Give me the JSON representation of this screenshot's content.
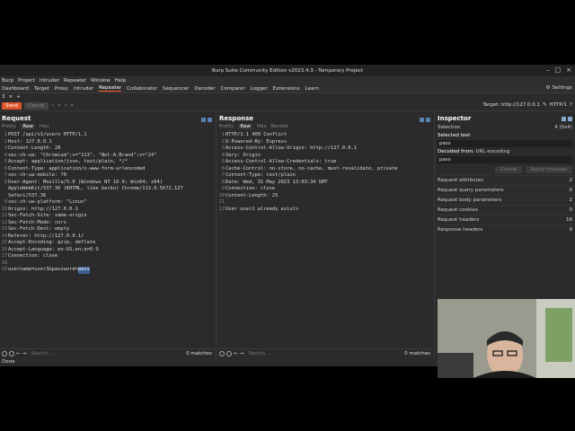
{
  "window": {
    "title": "Burp Suite Community Edition v2023.4.3 - Temporary Project",
    "controls": [
      "–",
      "□",
      "×"
    ]
  },
  "menu": [
    "Burp",
    "Project",
    "Intruder",
    "Repeater",
    "Window",
    "Help"
  ],
  "tabs": [
    "Dashboard",
    "Target",
    "Proxy",
    "Intruder",
    "Repeater",
    "Collaborator",
    "Sequencer",
    "Decoder",
    "Comparer",
    "Logger",
    "Extensions",
    "Learn"
  ],
  "active_tab": "Repeater",
  "settings_label": "Settings",
  "subtab": {
    "label": "3",
    "close": "×",
    "add": "+"
  },
  "toolbar": {
    "send": "Send",
    "cancel": "Cancel",
    "nav": [
      "<",
      "▾",
      ">",
      "▾"
    ],
    "target": "Target: http://127.0.0.1",
    "http": "HTTP/1"
  },
  "request": {
    "title": "Request",
    "tabs": [
      "Pretty",
      "Raw",
      "Hex"
    ],
    "active": "Raw",
    "lines": [
      {
        "n": "1",
        "t": "POST /api/v1/users HTTP/1.1"
      },
      {
        "n": "2",
        "t": "Host: 127.0.0.1"
      },
      {
        "n": "3",
        "t": "Content-Length: 28"
      },
      {
        "n": "4",
        "t": "sec-ch-ua: \"Chromium\";v=\"113\", \"Not-A.Brand\";v=\"24\""
      },
      {
        "n": "5",
        "t": "Accept: application/json, text/plain, */*"
      },
      {
        "n": "6",
        "t": "Content-Type: application/x-www-form-urlencoded"
      },
      {
        "n": "7",
        "t": "sec-ch-ua-mobile: ?0"
      },
      {
        "n": "8",
        "t": "User-Agent: Mozilla/5.0 (Windows NT 10.0; Win64; x64)"
      },
      {
        "n": "",
        "t": "AppleWebKit/537.36 (KHTML, like Gecko) Chrome/113.0.5672.127"
      },
      {
        "n": "",
        "t": "Safari/537.36"
      },
      {
        "n": "9",
        "t": "sec-ch-ua-platform: \"Linux\""
      },
      {
        "n": "10",
        "t": "Origin: http://127.0.0.1"
      },
      {
        "n": "11",
        "t": "Sec-Fetch-Site: same-origin"
      },
      {
        "n": "12",
        "t": "Sec-Fetch-Mode: cors"
      },
      {
        "n": "13",
        "t": "Sec-Fetch-Dest: empty"
      },
      {
        "n": "14",
        "t": "Referer: http://127.0.0.1/"
      },
      {
        "n": "15",
        "t": "Accept-Encoding: gzip, deflate"
      },
      {
        "n": "16",
        "t": "Accept-Language: en-US,en;q=0.9"
      },
      {
        "n": "17",
        "t": "Connection: close"
      },
      {
        "n": "18",
        "t": ""
      },
      {
        "n": "19",
        "t": "username=user3&password="
      }
    ],
    "highlight": "pass",
    "search_placeholder": "Search...",
    "matches": "0 matches"
  },
  "response": {
    "title": "Response",
    "tabs": [
      "Pretty",
      "Raw",
      "Hex",
      "Render"
    ],
    "active": "Raw",
    "lines": [
      {
        "n": "1",
        "t": "HTTP/1.1 409 Conflict"
      },
      {
        "n": "2",
        "t": "X-Powered-By: Express"
      },
      {
        "n": "3",
        "t": "Access-Control-Allow-Origin: http://127.0.0.1"
      },
      {
        "n": "4",
        "t": "Vary: Origin"
      },
      {
        "n": "5",
        "t": "Access-Control-Allow-Credentials: true"
      },
      {
        "n": "6",
        "t": "Cache-Control: no-store, no-cache, must-revalidate, private"
      },
      {
        "n": "7",
        "t": "Content-Type: text/plain"
      },
      {
        "n": "8",
        "t": "Date: Wed, 31 May 2023 13:03:34 GMT"
      },
      {
        "n": "9",
        "t": "Connection: close"
      },
      {
        "n": "10",
        "t": "Content-Length: 25"
      },
      {
        "n": "11",
        "t": ""
      },
      {
        "n": "12",
        "t": "User user2 already exists"
      }
    ],
    "search_placeholder": "Search...",
    "matches": "0 matches"
  },
  "inspector": {
    "title": "Inspector",
    "selection_label": "Selection",
    "selection_value": "4 (0x4)",
    "selected_text_label": "Selected text",
    "selected_text": "pass",
    "decoded_label": "Decoded from:",
    "decoded_mode": "URL encoding",
    "decoded_text": "pass",
    "cancel": "Cancel",
    "apply": "Apply changes",
    "rows": [
      {
        "label": "Request attributes",
        "count": "2"
      },
      {
        "label": "Request query parameters",
        "count": "0"
      },
      {
        "label": "Request body parameters",
        "count": "2"
      },
      {
        "label": "Request cookies",
        "count": "0"
      },
      {
        "label": "Request headers",
        "count": "16"
      },
      {
        "label": "Response headers",
        "count": "9"
      }
    ]
  },
  "status": "Done"
}
